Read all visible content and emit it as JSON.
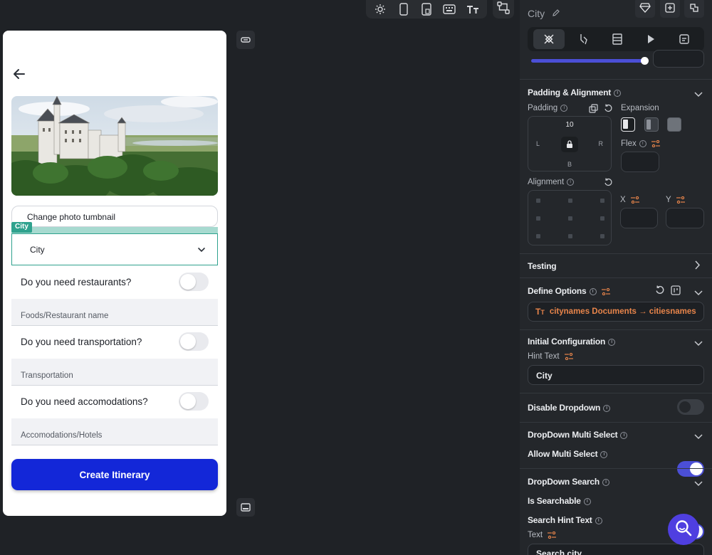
{
  "toolbar": {
    "icons": [
      "sun-icon",
      "phone-icon",
      "tablet-icon",
      "keyboard-icon",
      "text-size-icon",
      "connections-icon"
    ]
  },
  "preview": {
    "photo_button_label": "Change photo tumbnail",
    "dropdown_tag": "City",
    "dropdown_value": "City",
    "questions": [
      {
        "label": "Do you need restaurants?",
        "field_placeholder": "Foods/Restaurant name",
        "enabled": false
      },
      {
        "label": "Do you need transportation?",
        "field_placeholder": "Transportation",
        "enabled": false
      },
      {
        "label": "Do you need accomodations?",
        "field_placeholder": "Accomodations/Hotels",
        "enabled": false
      }
    ],
    "cta_label": "Create Itinerary"
  },
  "panel": {
    "widget_name": "City",
    "padding_section": {
      "title": "Padding & Alignment",
      "padding_label": "Padding",
      "top": "10",
      "left": "L",
      "right": "R",
      "bottom": "B",
      "expansion_label": "Expansion",
      "flex_label": "Flex",
      "alignment_label": "Alignment",
      "x_label": "X",
      "y_label": "Y"
    },
    "testing_title": "Testing",
    "define_options": {
      "title": "Define Options",
      "value": "citynames Documents → citiesnames"
    },
    "initial_config": {
      "title": "Initial Configuration",
      "hint_label": "Hint Text",
      "hint_value": "City"
    },
    "disable_dropdown": {
      "title": "Disable Dropdown",
      "enabled": false
    },
    "multi_select": {
      "title": "DropDown Multi Select",
      "allow_label": "Allow Multi Select",
      "enabled": true
    },
    "search": {
      "title": "DropDown Search",
      "searchable_label": "Is Searchable",
      "searchable": true,
      "hint_title": "Search Hint Text",
      "text_label": "Text",
      "text_value": "Search city"
    }
  },
  "colors": {
    "accent": "#4b4fd6",
    "cta": "#1327d8",
    "teal": "#2fa28e",
    "orange": "#e7844a"
  }
}
